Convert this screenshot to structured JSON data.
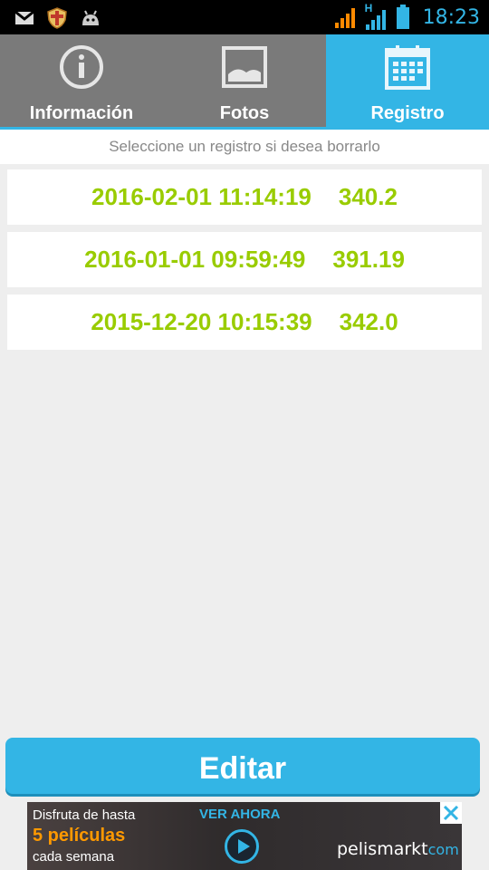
{
  "status_bar": {
    "time": "18:23",
    "network_label": "H",
    "icons": [
      "gmail-icon",
      "shield-icon",
      "android-icon",
      "signal-icon",
      "signal-h-icon",
      "battery-icon"
    ]
  },
  "tabs": [
    {
      "label": "Información",
      "icon": "info-icon",
      "active": false
    },
    {
      "label": "Fotos",
      "icon": "image-icon",
      "active": false
    },
    {
      "label": "Registro",
      "icon": "calendar-icon",
      "active": true
    }
  ],
  "hint": "Seleccione un registro si desea borrarlo",
  "records": [
    {
      "date": "2016-02-01 11:14:19",
      "value": "340.2"
    },
    {
      "date": "2016-01-01 09:59:49",
      "value": "391.19"
    },
    {
      "date": "2015-12-20 10:15:39",
      "value": "342.0"
    }
  ],
  "edit_button": "Editar",
  "ad": {
    "line1": "Disfruta de hasta",
    "line2": "5 películas",
    "line3": "cada semana",
    "cta": "VER AHORA",
    "brand": "pelismarkt",
    "brand_domain": "com"
  },
  "colors": {
    "accent": "#33b5e5",
    "tab_inactive": "#7a7a7a",
    "record_text": "#99cc00",
    "ad_highlight": "#ff9900"
  }
}
